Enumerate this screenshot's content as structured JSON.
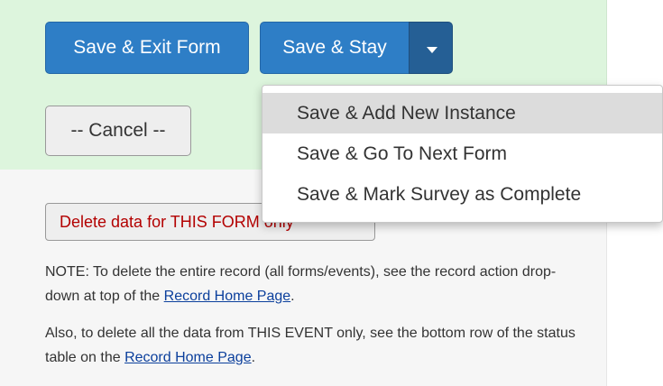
{
  "buttons": {
    "save_exit": "Save & Exit Form",
    "save_stay": "Save & Stay",
    "cancel": "-- Cancel --",
    "delete_form": "Delete data for THIS FORM only"
  },
  "dropdown": {
    "items": [
      {
        "label": "Save & Add New Instance",
        "highlighted": true
      },
      {
        "label": "Save & Go To Next Form"
      },
      {
        "label": "Save & Mark Survey as Complete"
      }
    ]
  },
  "notes": {
    "note1_text": "NOTE: To delete the entire record (all forms/events), see the record action drop-down at top of the ",
    "note1_link": "Record Home Page",
    "note1_end": ".",
    "note2_text": "Also, to delete all the data from THIS EVENT only, see the bottom row of the status table on the ",
    "note2_link": "Record Home Page",
    "note2_end": "."
  },
  "colors": {
    "primary": "#2e7ec6",
    "primary_dark": "#255f95",
    "panel_green": "#ddf5dd",
    "danger_text": "#b30000"
  },
  "icons": {
    "caret": "caret-down-icon"
  }
}
